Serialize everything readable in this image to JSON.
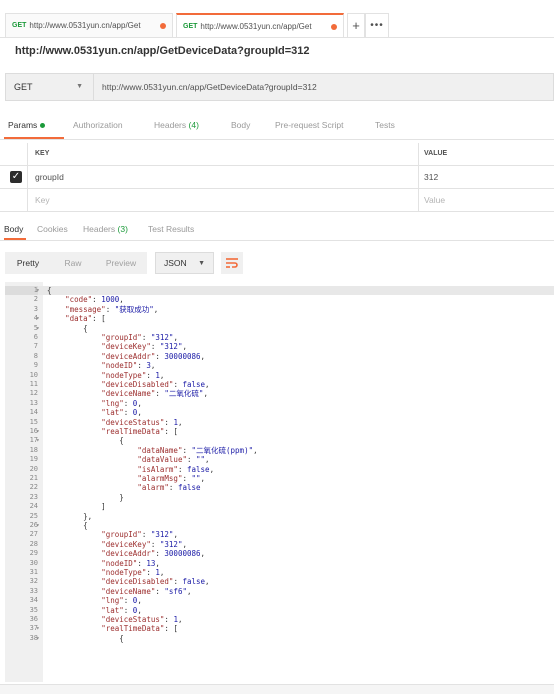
{
  "tabs": [
    {
      "method": "GET",
      "url": "http://www.0531yun.cn/app/Get",
      "active": false
    },
    {
      "method": "GET",
      "url": "http://www.0531yun.cn/app/Get",
      "active": true
    }
  ],
  "tab_add_label": "+",
  "tab_more_label": "•••",
  "request_title": "http://www.0531yun.cn/app/GetDeviceData?groupId=312",
  "method": "GET",
  "url": "http://www.0531yun.cn/app/GetDeviceData?groupId=312",
  "request_tabs": {
    "params": "Params",
    "authorization": "Authorization",
    "headers": "Headers",
    "headers_count": "(4)",
    "body": "Body",
    "prerequest": "Pre-request Script",
    "tests": "Tests"
  },
  "params_table": {
    "key_header": "KEY",
    "value_header": "VALUE",
    "rows": [
      {
        "key": "groupId",
        "value": "312",
        "checked": true
      }
    ],
    "placeholder_key": "Key",
    "placeholder_value": "Value"
  },
  "response_tabs": {
    "body": "Body",
    "cookies": "Cookies",
    "headers": "Headers",
    "headers_count": "(3)",
    "test_results": "Test Results"
  },
  "format_buttons": {
    "pretty": "Pretty",
    "raw": "Raw",
    "preview": "Preview",
    "json": "JSON"
  },
  "code_lines": [
    "{",
    "    \"code\": 1000,",
    "    \"message\": \"获取成功\",",
    "    \"data\": [",
    "        {",
    "            \"groupId\": \"312\",",
    "            \"deviceKey\": \"312\",",
    "            \"deviceAddr\": 30000086,",
    "            \"nodeID\": 3,",
    "            \"nodeType\": 1,",
    "            \"deviceDisabled\": false,",
    "            \"deviceName\": \"二氧化硫\",",
    "            \"lng\": 0,",
    "            \"lat\": 0,",
    "            \"deviceStatus\": 1,",
    "            \"realTimeData\": [",
    "                {",
    "                    \"dataName\": \"二氧化硫(ppm)\",",
    "                    \"dataValue\": \"\",",
    "                    \"isAlarm\": false,",
    "                    \"alarmMsg\": \"\",",
    "                    \"alarm\": false",
    "                }",
    "            ]",
    "        },",
    "        {",
    "            \"groupId\": \"312\",",
    "            \"deviceKey\": \"312\",",
    "            \"deviceAddr\": 30000086,",
    "            \"nodeID\": 13,",
    "            \"nodeType\": 1,",
    "            \"deviceDisabled\": false,",
    "            \"deviceName\": \"sf6\",",
    "            \"lng\": 0,",
    "            \"lat\": 0,",
    "            \"deviceStatus\": 1,",
    "            \"realTimeData\": [",
    "                {"
  ],
  "fold_lines": [
    1,
    4,
    5,
    16,
    17,
    26,
    37,
    38
  ],
  "colors": {
    "accent": "#f26b3a",
    "get_method": "#1c9a3a",
    "string": "#1a1aa6",
    "key": "#9c2e2e"
  },
  "icons": {
    "wrap": "wrap-lines-icon",
    "check": "checkmark-icon"
  }
}
